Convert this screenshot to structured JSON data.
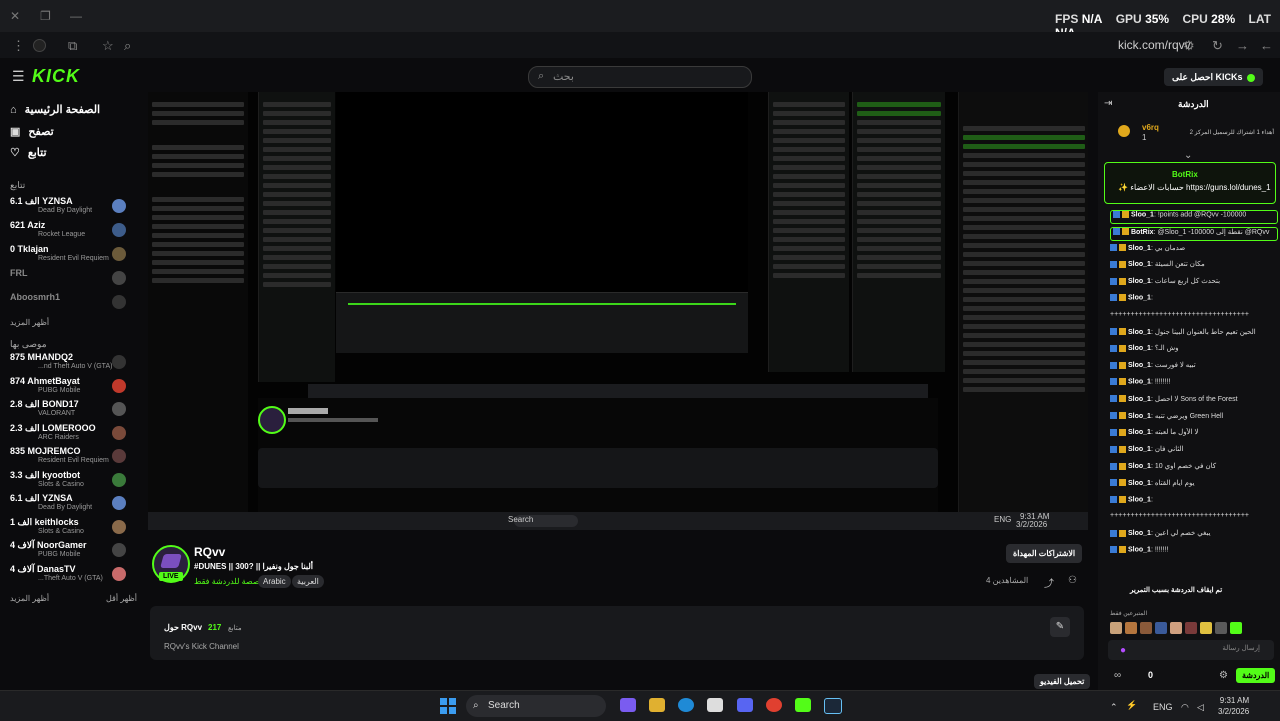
{
  "overlay": {
    "fps_label": "FPS",
    "fps_value": "N/A",
    "gpu_label": "GPU",
    "gpu_value": "35%",
    "cpu_label": "CPU",
    "cpu_value": "28%",
    "lat_label": "LAT",
    "lat_value": "N/A"
  },
  "browser": {
    "url": "kick.com/rqvv"
  },
  "header": {
    "logo": "KICK",
    "search_placeholder": "بحث",
    "kicks_button": "احصل على KICKs"
  },
  "sidebar": {
    "nav": [
      {
        "label": "الصفحة الرئيسية",
        "icon": "home-icon"
      },
      {
        "label": "تصفح",
        "icon": "browse-icon"
      },
      {
        "label": "تتابع",
        "icon": "heart-icon"
      }
    ],
    "following_title": "تتابع",
    "following": [
      {
        "name": "YZNSA",
        "count": "6.1 الف",
        "game": "Dead By Daylight",
        "color": "#5b7fbf"
      },
      {
        "name": "Aziz",
        "count": "621",
        "game": "Rocket League",
        "color": "#3d5c8a"
      },
      {
        "name": "Tklajan",
        "count": "0",
        "game": "Resident Evil Requiem",
        "color": "#6b5a3a"
      },
      {
        "name": "FRL",
        "count": "",
        "game": "",
        "color": "#444"
      },
      {
        "name": "Aboosmrh1",
        "count": "",
        "game": "",
        "color": "#333"
      }
    ],
    "show_more_1": "أظهر المزيد",
    "recommended_title": "موصى بها",
    "recommended": [
      {
        "name": "MHANDQ2",
        "count": "875",
        "game": "...nd Theft Auto V (GTA)",
        "color": "#333"
      },
      {
        "name": "AhmetBayat",
        "count": "874",
        "game": "PUBG Mobile",
        "color": "#c0392b"
      },
      {
        "name": "BOND17",
        "count": "2.8 الف",
        "game": "VALORANT",
        "color": "#555"
      },
      {
        "name": "LOMEROOO",
        "count": "2.3 الف",
        "game": "ARC Raiders",
        "color": "#7a4a3a"
      },
      {
        "name": "MOJREMCO",
        "count": "835",
        "game": "Resident Evil Requiem",
        "color": "#5a3a3a"
      },
      {
        "name": "kyootbot",
        "count": "3.3 الف",
        "game": "Slots & Casino",
        "color": "#3a7a3a"
      },
      {
        "name": "YZNSA",
        "count": "6.1 الف",
        "game": "Dead By Daylight",
        "color": "#5b7fbf"
      },
      {
        "name": "keithlocks",
        "count": "1 الف",
        "game": "Slots & Casino",
        "color": "#8a6a4a"
      },
      {
        "name": "NoorGamer",
        "count": "4 آلاف",
        "game": "PUBG Mobile",
        "color": "#444"
      },
      {
        "name": "DanasTV",
        "count": "4 آلاف",
        "game": "...Theft Auto V (GTA)",
        "color": "#c86a6a"
      }
    ],
    "show_more_2": "أظهر المزيد",
    "show_less": "أظهر أقل"
  },
  "stream": {
    "channel": "RQvv",
    "title": "#DUNES || 300? || ألبنا جول ونفيرا",
    "category": "مخصصة للدردشة فقط",
    "tags": [
      "Arabic",
      "العربية"
    ],
    "live": "LIVE",
    "subscribe": "الاشتراكات المهداة",
    "viewers": "4 المشاهدين",
    "about_title": "حول RQvv",
    "followers_count": "217",
    "followers_label": "متابع",
    "about_desc": "RQvv's Kick Channel",
    "clip_button": "تحميل الفيديو",
    "inner_search": "Search",
    "inner_lang": "ENG",
    "inner_time": "9:31 AM",
    "inner_date": "3/2/2026"
  },
  "chat": {
    "title": "الدردشة",
    "pinned_user": "v6rq",
    "pinned_n": "1",
    "pinned_text": "أهداء 1 اشتراك للرسميل المركز 2",
    "bot_name": "BotRix",
    "bot_msg": "✨ حسابات الاعضاء https://guns.lol/dunes_1",
    "messages": [
      {
        "user": "Sloo_1",
        "text": ": !points add @RQvv -100000",
        "hl": true
      },
      {
        "user": "BotRix",
        "text": ": @Sloo_1 -100000 نقطة إلى @RQvv",
        "hl": true
      },
      {
        "user": "Sloo_1",
        "text": ": صدمان بي",
        "hl": false
      },
      {
        "user": "Sloo_1",
        "text": ": مكان تتعن السيئة",
        "hl": false
      },
      {
        "user": "Sloo_1",
        "text": ": بتحدث كل اربع ساعات",
        "hl": false
      },
      {
        "user": "Sloo_1",
        "text": ":",
        "hl": false
      },
      {
        "user": "",
        "text": "++++++++++++++++++++++++++++++++++",
        "hl": false
      },
      {
        "user": "Sloo_1",
        "text": ": الحين تعيم حاط بالعنوان البينا جنول",
        "hl": false
      },
      {
        "user": "Sloo_1",
        "text": ": وش الـ؟",
        "hl": false
      },
      {
        "user": "Sloo_1",
        "text": ": تبيه لا فورست",
        "hl": false
      },
      {
        "user": "Sloo_1",
        "text": ": !!!!!!!!",
        "hl": false
      },
      {
        "user": "Sloo_1",
        "text": ": لا احصل Sons of the Forest",
        "hl": false
      },
      {
        "user": "Sloo_1",
        "text": ": ويرضي تتبه Green Hell",
        "hl": false
      },
      {
        "user": "Sloo_1",
        "text": ": لا الأول ما لعبته",
        "hl": false
      },
      {
        "user": "Sloo_1",
        "text": ": الثاني فان",
        "hl": false
      },
      {
        "user": "Sloo_1",
        "text": ": كان في خصم اوي 10",
        "hl": false
      },
      {
        "user": "Sloo_1",
        "text": ": يوم ايام القتاه",
        "hl": false
      },
      {
        "user": "Sloo_1",
        "text": ":",
        "hl": false
      },
      {
        "user": "",
        "text": "++++++++++++++++++++++++++++++++++",
        "hl": false
      },
      {
        "user": "Sloo_1",
        "text": ": يبغي خصم لي اعين",
        "hl": false
      },
      {
        "user": "Sloo_1",
        "text": ": !!!!!!!",
        "hl": false
      }
    ],
    "paused": "تم ايقاف الدردشة بسبب التمرير",
    "top_label": "المتبرعين فقط",
    "input_placeholder": "إرسال رسالة",
    "points": "0",
    "send_button": "الدردشة"
  },
  "taskbar": {
    "search": "Search",
    "lang": "ENG",
    "time": "9:31 AM",
    "date": "3/2/2026"
  },
  "colors": {
    "kick_green": "#53fc18",
    "background": "#0b0b0d",
    "panel": "#18191c"
  }
}
